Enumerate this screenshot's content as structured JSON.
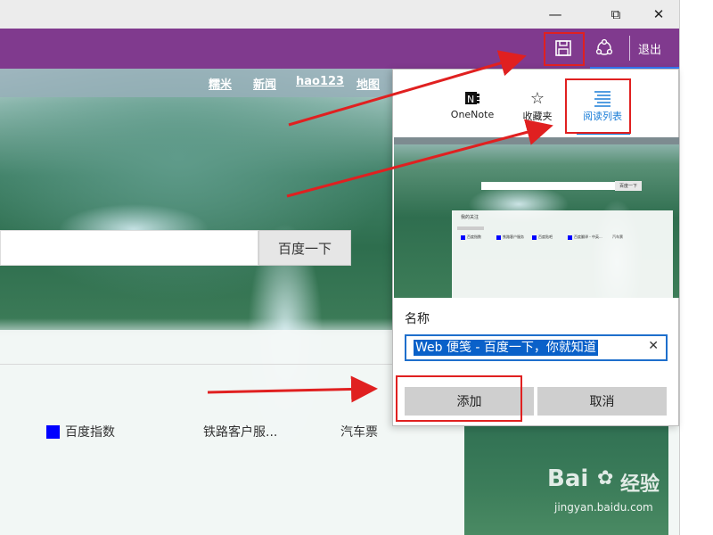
{
  "window": {
    "minimize_icon": "minimize-icon",
    "maximize_icon": "restore-icon",
    "close_icon": "close-icon"
  },
  "toolbar": {
    "exit_label": "退出",
    "accent": "#803a8e"
  },
  "page": {
    "nav_links": [
      "糯米",
      "新闻",
      "hao123",
      "地图"
    ],
    "search_button": "百度一下",
    "links": [
      "百度指数",
      "铁路客户服...",
      "汽车票"
    ]
  },
  "panel": {
    "tabs": [
      {
        "label": "OneNote",
        "icon": "onenote-icon"
      },
      {
        "label": "收藏夹",
        "icon": "star-icon"
      },
      {
        "label": "阅读列表",
        "icon": "reading-list-icon"
      }
    ],
    "preview_button": "百度一下",
    "preview_title": "我的关注",
    "preview_links": [
      "百度指数",
      "铁路客户服务",
      "百度贴吧",
      "百度翻译 - 中英...",
      "汽车票"
    ],
    "name_label": "名称",
    "name_value": "Web 便笺 - 百度一下，你就知道",
    "add_button": "添加",
    "cancel_button": "取消"
  },
  "watermark": {
    "brand": "Bai",
    "brand2": "经验",
    "url": "jingyan.baidu.com"
  }
}
